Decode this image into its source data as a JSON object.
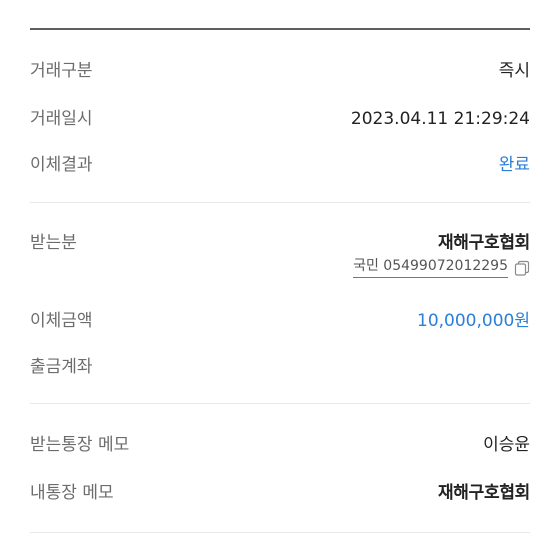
{
  "transaction": {
    "type_label": "거래구분",
    "type_value": "즉시",
    "datetime_label": "거래일시",
    "datetime_value": "2023.04.11 21:29:24",
    "result_label": "이체결과",
    "result_value": "완료"
  },
  "transfer": {
    "recipient_label": "받는분",
    "recipient_name": "재해구호협회",
    "recipient_account": "국민 05499072012295",
    "amount_label": "이체금액",
    "amount_value": "10,000,000원",
    "withdraw_account_label": "출금계좌",
    "withdraw_account_value": ""
  },
  "memo": {
    "recipient_memo_label": "받는통장 메모",
    "recipient_memo_value": "이승윤",
    "my_memo_label": "내통장 메모",
    "my_memo_value": "재해구호협회"
  },
  "icons": {
    "copy": "copy-icon"
  },
  "colors": {
    "accent": "#2b7fd6",
    "divider": "#e9e9e9",
    "top_rule": "#5f5f5f"
  }
}
